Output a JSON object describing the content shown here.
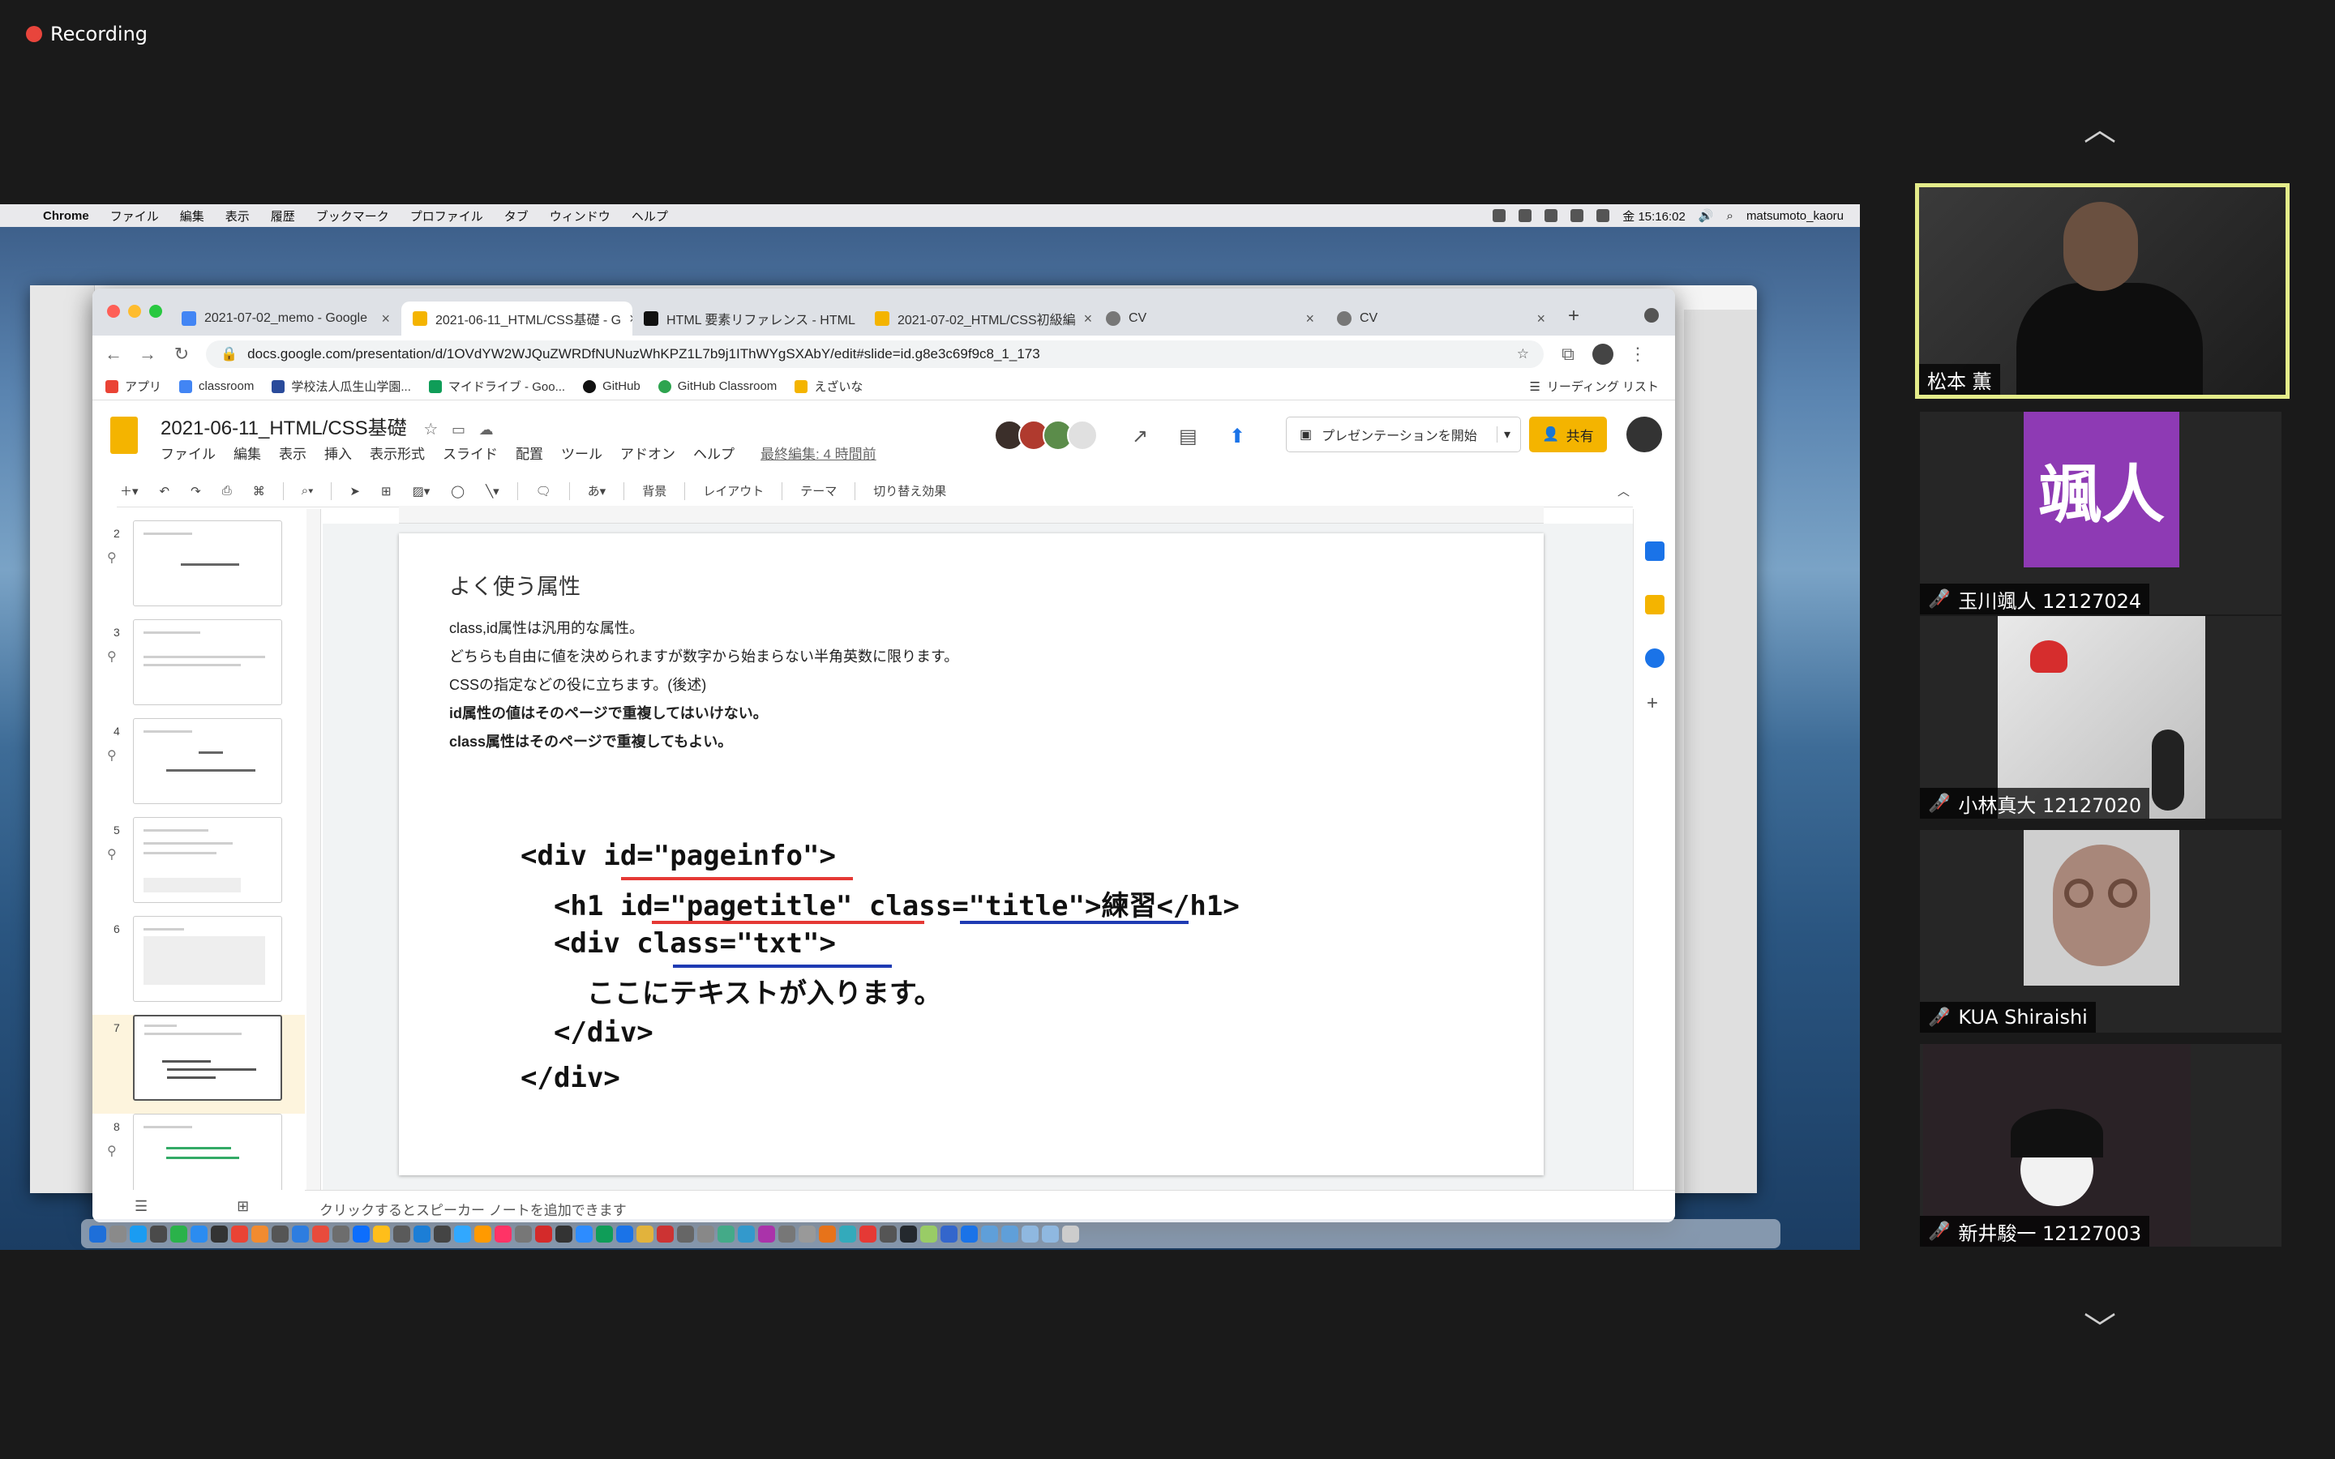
{
  "zoom": {
    "recording_label": "Recording",
    "participants": [
      {
        "name": "松本 薫",
        "muted": false,
        "active": true
      },
      {
        "name": "玉川颯人 12127024",
        "muted": true,
        "avatar_text": "颯人",
        "avatar_color": "#8e3ab4"
      },
      {
        "name": "小林真大 12127020",
        "muted": true
      },
      {
        "name": "KUA Shiraishi",
        "muted": true
      },
      {
        "name": "新井駿一 12127003",
        "muted": true
      }
    ]
  },
  "mac_menu": {
    "app": "Chrome",
    "items": [
      "ファイル",
      "編集",
      "表示",
      "履歴",
      "ブックマーク",
      "プロファイル",
      "タブ",
      "ウィンドウ",
      "ヘルプ"
    ],
    "clock": "金 15:16:02",
    "user": "matsumoto_kaoru"
  },
  "chrome": {
    "tabs": [
      {
        "title": "2021-07-02_memo - Google",
        "color": "#4285f4",
        "active": false
      },
      {
        "title": "2021-06-11_HTML/CSS基礎 - G",
        "color": "#f4b400",
        "active": true
      },
      {
        "title": "HTML 要素リファレンス - HTML",
        "color": "#111111",
        "active": false
      },
      {
        "title": "2021-07-02_HTML/CSS初級編",
        "color": "#f4b400",
        "active": false
      },
      {
        "title": "CV",
        "color": "#777777",
        "active": false
      },
      {
        "title": "CV",
        "color": "#777777",
        "active": false
      }
    ],
    "url": "docs.google.com/presentation/d/1OVdYW2WJQuZWRDfNUNuzWhKPZ1L7b9j1IThWYgSXAbY/edit#slide=id.g8e3c69f9c8_1_173",
    "bookmarks": [
      "アプリ",
      "classroom",
      "学校法人瓜生山学園...",
      "マイドライブ - Goo...",
      "GitHub",
      "GitHub Classroom",
      "えざいな"
    ],
    "reading_list": "リーディング リスト"
  },
  "slides": {
    "doc_title": "2021-06-11_HTML/CSS基礎",
    "menu": [
      "ファイル",
      "編集",
      "表示",
      "挿入",
      "表示形式",
      "スライド",
      "配置",
      "ツール",
      "アドオン",
      "ヘルプ"
    ],
    "last_edit": "最終編集: 4 時間前",
    "present_label": "プレゼンテーションを開始",
    "share_label": "共有",
    "toolbar": {
      "background": "背景",
      "layout": "レイアウト",
      "theme": "テーマ",
      "transition": "切り替え効果"
    },
    "thumb_numbers": [
      "2",
      "3",
      "4",
      "5",
      "6",
      "7",
      "8"
    ],
    "active_slide": "7",
    "notes_placeholder": "クリックするとスピーカー ノートを追加できます"
  },
  "slide": {
    "title": "よく使う属性",
    "lines": [
      "class,id属性は汎用的な属性。",
      "どちらも自由に値を決められますが数字から始まらない半角英数に限ります。",
      "CSSの指定などの役に立ちます。(後述)"
    ],
    "bold_lines": [
      "id属性の値はそのページで重複してはいけない。",
      "class属性はそのページで重複してもよい。"
    ],
    "code": [
      "<div id=\"pageinfo\">",
      "  <h1 id=\"pagetitle\" class=\"title\">練習</h1>",
      "  <div class=\"txt\">",
      "    ここにテキストが入ります。",
      "  </div>",
      "</div>"
    ],
    "underline_red": "#e53935",
    "underline_blue": "#1f3bb3"
  }
}
